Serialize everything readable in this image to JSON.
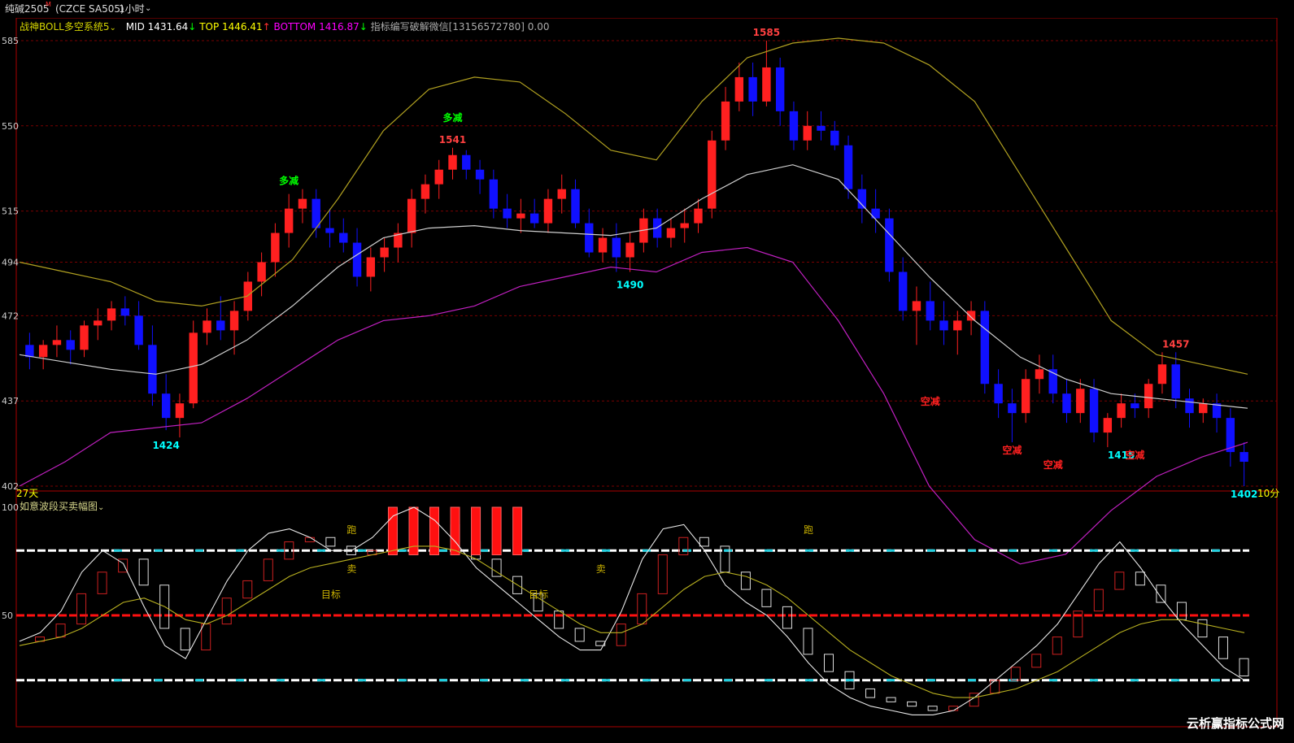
{
  "header": {
    "symbol": "纯碱2505",
    "symbol_superscript": "M",
    "code": "(CZCE SA505)",
    "period": "1小时",
    "period_chevron": "chevron-down-icon"
  },
  "indicator1": {
    "name": "战神BOLL多空系统5",
    "mid_label": "MID",
    "mid_value": "1431.64",
    "top_label": "TOP",
    "top_value": "1446.41",
    "bottom_label": "BOTTOM",
    "bottom_value": "1416.87",
    "note": "指标编写破解微信[13156572780] 0.00",
    "colors": {
      "name": "#d4d400",
      "mid": "#ffffff",
      "top": "#ffff00",
      "bottom": "#ff00ff",
      "note": "#aaaaaa"
    }
  },
  "indicator2": {
    "name": "如意波段买卖幅图"
  },
  "corner": {
    "left_bottom": "27天",
    "right_bottom": "10分"
  },
  "watermark": "云析赢指标公式网",
  "colors": {
    "up": "#ff2020",
    "down": "#1010ff",
    "grid": "#7a0000",
    "border": "#aa0000"
  },
  "chart_data": [
    {
      "type": "candlestick",
      "y_ticks": [
        1585,
        1550,
        1515,
        1494,
        1472,
        1437,
        1402
      ],
      "y_tick_labels": [
        "585",
        "550",
        "515",
        "494",
        "472",
        "437",
        "402"
      ],
      "ylim": [
        1402,
        1585
      ],
      "candles": [
        [
          1460,
          1465,
          1450,
          1455
        ],
        [
          1455,
          1462,
          1450,
          1460
        ],
        [
          1460,
          1468,
          1455,
          1462
        ],
        [
          1462,
          1466,
          1452,
          1458
        ],
        [
          1458,
          1470,
          1455,
          1468
        ],
        [
          1468,
          1475,
          1462,
          1470
        ],
        [
          1470,
          1478,
          1466,
          1475
        ],
        [
          1475,
          1480,
          1468,
          1472
        ],
        [
          1472,
          1478,
          1458,
          1460
        ],
        [
          1460,
          1468,
          1435,
          1440
        ],
        [
          1440,
          1448,
          1425,
          1430
        ],
        [
          1430,
          1440,
          1422,
          1436
        ],
        [
          1436,
          1470,
          1434,
          1465
        ],
        [
          1465,
          1475,
          1460,
          1470
        ],
        [
          1470,
          1480,
          1462,
          1466
        ],
        [
          1466,
          1478,
          1456,
          1474
        ],
        [
          1474,
          1490,
          1470,
          1486
        ],
        [
          1486,
          1498,
          1480,
          1494
        ],
        [
          1494,
          1510,
          1488,
          1506
        ],
        [
          1506,
          1522,
          1500,
          1516
        ],
        [
          1516,
          1524,
          1510,
          1520
        ],
        [
          1520,
          1524,
          1504,
          1508
        ],
        [
          1508,
          1516,
          1500,
          1506
        ],
        [
          1506,
          1512,
          1498,
          1502
        ],
        [
          1502,
          1508,
          1484,
          1488
        ],
        [
          1488,
          1500,
          1482,
          1496
        ],
        [
          1496,
          1504,
          1490,
          1500
        ],
        [
          1500,
          1510,
          1494,
          1506
        ],
        [
          1506,
          1524,
          1500,
          1520
        ],
        [
          1520,
          1530,
          1514,
          1526
        ],
        [
          1526,
          1536,
          1520,
          1532
        ],
        [
          1532,
          1541,
          1528,
          1538
        ],
        [
          1538,
          1540,
          1528,
          1532
        ],
        [
          1532,
          1536,
          1522,
          1528
        ],
        [
          1528,
          1532,
          1512,
          1516
        ],
        [
          1516,
          1522,
          1508,
          1512
        ],
        [
          1512,
          1520,
          1506,
          1514
        ],
        [
          1514,
          1520,
          1508,
          1510
        ],
        [
          1510,
          1524,
          1506,
          1520
        ],
        [
          1520,
          1530,
          1514,
          1524
        ],
        [
          1524,
          1528,
          1508,
          1510
        ],
        [
          1510,
          1516,
          1496,
          1498
        ],
        [
          1498,
          1508,
          1494,
          1504
        ],
        [
          1504,
          1510,
          1490,
          1496
        ],
        [
          1496,
          1506,
          1490,
          1502
        ],
        [
          1502,
          1516,
          1498,
          1512
        ],
        [
          1512,
          1516,
          1500,
          1504
        ],
        [
          1504,
          1512,
          1500,
          1508
        ],
        [
          1508,
          1516,
          1502,
          1510
        ],
        [
          1510,
          1520,
          1506,
          1516
        ],
        [
          1516,
          1548,
          1512,
          1544
        ],
        [
          1544,
          1566,
          1540,
          1560
        ],
        [
          1560,
          1576,
          1556,
          1570
        ],
        [
          1570,
          1576,
          1554,
          1560
        ],
        [
          1560,
          1585,
          1558,
          1574
        ],
        [
          1574,
          1578,
          1550,
          1556
        ],
        [
          1556,
          1560,
          1540,
          1544
        ],
        [
          1544,
          1556,
          1540,
          1550
        ],
        [
          1550,
          1556,
          1544,
          1548
        ],
        [
          1548,
          1552,
          1540,
          1542
        ],
        [
          1542,
          1546,
          1520,
          1524
        ],
        [
          1524,
          1530,
          1510,
          1516
        ],
        [
          1516,
          1524,
          1506,
          1512
        ],
        [
          1512,
          1516,
          1486,
          1490
        ],
        [
          1490,
          1496,
          1470,
          1474
        ],
        [
          1474,
          1484,
          1460,
          1478
        ],
        [
          1478,
          1486,
          1466,
          1470
        ],
        [
          1470,
          1478,
          1460,
          1466
        ],
        [
          1466,
          1474,
          1456,
          1470
        ],
        [
          1470,
          1478,
          1464,
          1474
        ],
        [
          1474,
          1478,
          1440,
          1444
        ],
        [
          1444,
          1450,
          1430,
          1436
        ],
        [
          1436,
          1442,
          1420,
          1432
        ],
        [
          1432,
          1450,
          1428,
          1446
        ],
        [
          1446,
          1456,
          1440,
          1450
        ],
        [
          1450,
          1456,
          1436,
          1440
        ],
        [
          1440,
          1446,
          1428,
          1432
        ],
        [
          1432,
          1446,
          1428,
          1442
        ],
        [
          1442,
          1446,
          1420,
          1424
        ],
        [
          1424,
          1432,
          1418,
          1430
        ],
        [
          1430,
          1440,
          1426,
          1436
        ],
        [
          1436,
          1440,
          1430,
          1434
        ],
        [
          1434,
          1446,
          1430,
          1444
        ],
        [
          1444,
          1457,
          1440,
          1452
        ],
        [
          1452,
          1457,
          1434,
          1438
        ],
        [
          1438,
          1442,
          1426,
          1432
        ],
        [
          1432,
          1438,
          1428,
          1436
        ],
        [
          1436,
          1440,
          1424,
          1430
        ],
        [
          1430,
          1434,
          1410,
          1416
        ],
        [
          1416,
          1420,
          1402,
          1412
        ]
      ],
      "boll_top": [
        1494,
        1490,
        1486,
        1478,
        1476,
        1480,
        1495,
        1520,
        1548,
        1565,
        1570,
        1568,
        1555,
        1540,
        1536,
        1560,
        1578,
        1584,
        1586,
        1584,
        1575,
        1560,
        1530,
        1500,
        1470,
        1456,
        1452,
        1448
      ],
      "boll_mid": [
        1456,
        1453,
        1450,
        1448,
        1452,
        1462,
        1476,
        1492,
        1504,
        1508,
        1509,
        1507,
        1506,
        1505,
        1508,
        1520,
        1530,
        1534,
        1528,
        1508,
        1488,
        1470,
        1455,
        1446,
        1440,
        1438,
        1436,
        1434
      ],
      "boll_bottom": [
        1402,
        1412,
        1424,
        1426,
        1428,
        1438,
        1450,
        1462,
        1470,
        1472,
        1476,
        1484,
        1488,
        1492,
        1490,
        1498,
        1500,
        1494,
        1470,
        1440,
        1402,
        1380,
        1370,
        1374,
        1392,
        1406,
        1414,
        1420
      ],
      "annotations": [
        {
          "text": "1424",
          "color": "#00ffff",
          "bar": 10,
          "price": 1422,
          "pos": "below"
        },
        {
          "text": "多减",
          "color": "#00ff00",
          "bar": 19,
          "price": 1524,
          "pos": "above"
        },
        {
          "text": "1541",
          "color": "#ff4040",
          "bar": 31,
          "price": 1541,
          "pos": "above"
        },
        {
          "text": "多减",
          "color": "#00ff00",
          "bar": 31,
          "price": 1550,
          "pos": "above"
        },
        {
          "text": "1490",
          "color": "#00ffff",
          "bar": 44,
          "price": 1488,
          "pos": "below"
        },
        {
          "text": "1585",
          "color": "#ff4040",
          "bar": 54,
          "price": 1585,
          "pos": "above"
        },
        {
          "text": "空减",
          "color": "#ff2020",
          "bar": 66,
          "price": 1440,
          "pos": "below"
        },
        {
          "text": "空减",
          "color": "#ff2020",
          "bar": 72,
          "price": 1420,
          "pos": "below"
        },
        {
          "text": "空减",
          "color": "#ff2020",
          "bar": 75,
          "price": 1414,
          "pos": "below"
        },
        {
          "text": "1415",
          "color": "#00ffff",
          "bar": 80,
          "price": 1418,
          "pos": "below"
        },
        {
          "text": "空减",
          "color": "#ff2020",
          "bar": 81,
          "price": 1418,
          "pos": "below"
        },
        {
          "text": "1457",
          "color": "#ff4040",
          "bar": 84,
          "price": 1457,
          "pos": "above"
        },
        {
          "text": "1402",
          "color": "#00ffff",
          "bar": 89,
          "price": 1402,
          "pos": "below"
        }
      ]
    },
    {
      "type": "oscillator",
      "y_ticks": [
        100,
        50
      ],
      "y_tick_labels": [
        "100",
        "50"
      ],
      "ylim": [
        0,
        100
      ],
      "levels": [
        80,
        50,
        20
      ],
      "labels": [
        {
          "text": "跑",
          "x": 16,
          "y": 88
        },
        {
          "text": "卖",
          "x": 16,
          "y": 70
        },
        {
          "text": "目标",
          "x": 15,
          "y": 58
        },
        {
          "text": "跑",
          "x": 38,
          "y": 88
        },
        {
          "text": "卖",
          "x": 28,
          "y": 70
        },
        {
          "text": "目标",
          "x": 25,
          "y": 58
        }
      ],
      "fast": [
        38,
        40,
        46,
        60,
        70,
        76,
        64,
        44,
        34,
        46,
        58,
        66,
        76,
        84,
        86,
        82,
        78,
        80,
        90,
        96,
        92,
        84,
        76,
        68,
        60,
        52,
        44,
        38,
        36,
        46,
        60,
        78,
        86,
        82,
        70,
        62,
        54,
        44,
        32,
        24,
        16,
        12,
        10,
        8,
        6,
        8,
        14,
        20,
        26,
        32,
        40,
        52,
        62,
        70,
        64,
        56,
        48,
        40,
        30,
        22
      ],
      "slow": [
        36,
        38,
        40,
        44,
        50,
        56,
        58,
        54,
        48,
        46,
        50,
        56,
        62,
        68,
        72,
        74,
        76,
        78,
        80,
        82,
        82,
        80,
        76,
        70,
        64,
        58,
        52,
        46,
        42,
        42,
        46,
        54,
        62,
        68,
        70,
        68,
        64,
        58,
        50,
        42,
        34,
        28,
        22,
        18,
        14,
        12,
        12,
        14,
        16,
        20,
        24,
        30,
        36,
        42,
        46,
        48,
        48,
        46,
        44,
        42
      ],
      "thin": [
        38,
        42,
        52,
        70,
        80,
        74,
        54,
        36,
        30,
        48,
        66,
        80,
        88,
        90,
        86,
        80,
        80,
        86,
        96,
        100,
        94,
        84,
        72,
        64,
        56,
        48,
        40,
        34,
        34,
        52,
        76,
        90,
        92,
        80,
        64,
        56,
        50,
        40,
        28,
        18,
        12,
        8,
        6,
        4,
        4,
        6,
        12,
        20,
        28,
        36,
        46,
        60,
        74,
        84,
        72,
        58,
        46,
        36,
        26,
        20
      ],
      "red_bars": [
        18,
        19,
        20,
        21,
        22,
        23,
        24
      ]
    }
  ]
}
